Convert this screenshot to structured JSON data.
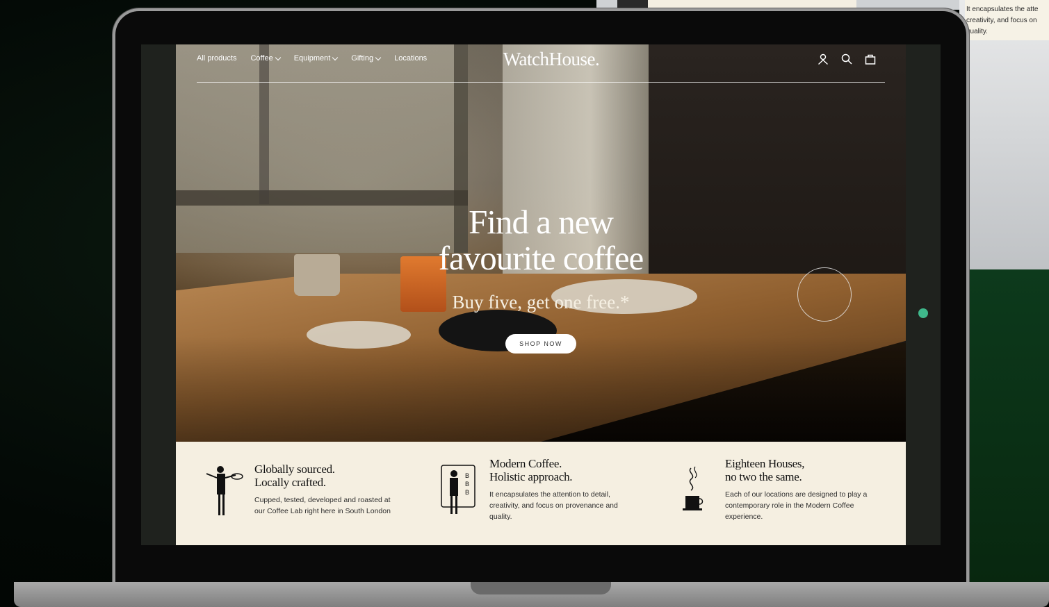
{
  "background": {
    "side_note": [
      "It encapsulates the atte",
      "creativity, and focus on",
      "quality."
    ]
  },
  "nav": {
    "links": [
      {
        "label": "All products",
        "has_dropdown": false
      },
      {
        "label": "Coffee",
        "has_dropdown": true
      },
      {
        "label": "Equipment",
        "has_dropdown": true
      },
      {
        "label": "Gifting",
        "has_dropdown": true
      },
      {
        "label": "Locations",
        "has_dropdown": false
      }
    ],
    "logo": "WatchHouse.",
    "icons": [
      "account-icon",
      "search-icon",
      "bag-icon"
    ]
  },
  "hero": {
    "title_line1": "Find a new",
    "title_line2": "favourite coffee",
    "subtitle": "Buy five, get one free.*",
    "cta": "SHOP NOW"
  },
  "features": [
    {
      "title_line1": "Globally sourced.",
      "title_line2": "Locally crafted.",
      "desc_line1": "Cupped, tested, developed and roasted at",
      "desc_line2": "our Coffee Lab right here in South London",
      "desc_line3": ""
    },
    {
      "title_line1": "Modern Coffee.",
      "title_line2": "Holistic approach.",
      "desc_line1": "It encapsulates the attention to detail,",
      "desc_line2": "creativity, and focus on provenance and",
      "desc_line3": "quality."
    },
    {
      "title_line1": "Eighteen Houses,",
      "title_line2": "no two the same.",
      "desc_line1": "Each of our locations are designed to play a",
      "desc_line2": "contemporary role in the Modern Coffee",
      "desc_line3": "experience."
    }
  ],
  "colors": {
    "accent_dot": "#3fb88b",
    "features_bg": "#f5efe1"
  }
}
